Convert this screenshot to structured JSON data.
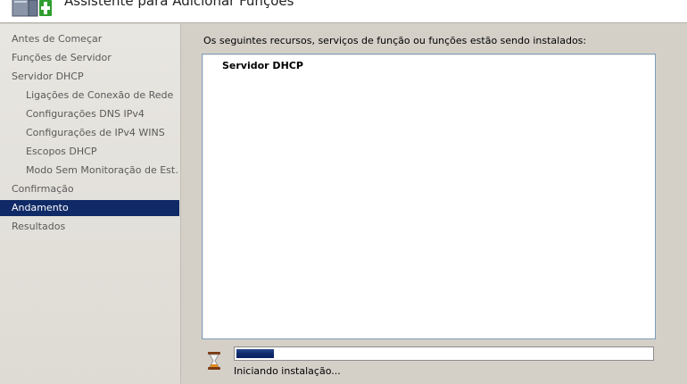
{
  "header": {
    "title": "Assistente para Adicionar Funções"
  },
  "sidebar": {
    "items": [
      {
        "label": "Antes de Começar",
        "level": 1,
        "active": false
      },
      {
        "label": "Funções de Servidor",
        "level": 1,
        "active": false
      },
      {
        "label": "Servidor DHCP",
        "level": 1,
        "active": false
      },
      {
        "label": "Ligações de Conexão de Rede",
        "level": 2,
        "active": false
      },
      {
        "label": "Configurações DNS IPv4",
        "level": 2,
        "active": false
      },
      {
        "label": "Configurações de IPv4 WINS",
        "level": 2,
        "active": false
      },
      {
        "label": "Escopos DHCP",
        "level": 2,
        "active": false
      },
      {
        "label": "Modo Sem Monitoração de Est...",
        "level": 2,
        "active": false
      },
      {
        "label": "Confirmação",
        "level": 1,
        "active": false
      },
      {
        "label": "Andamento",
        "level": 1,
        "active": true
      },
      {
        "label": "Resultados",
        "level": 1,
        "active": false
      }
    ]
  },
  "main": {
    "instructions": "Os seguintes recursos, serviços de função ou funções estão sendo instalados:",
    "installing_items": [
      "Servidor DHCP"
    ],
    "progress": {
      "fraction": 0.09,
      "status_text": "Iniciando instalação..."
    }
  },
  "colors": {
    "active_nav_bg": "#0f2a66",
    "progress_fill": "#0e2a6a",
    "window_bg": "#d4d0c8"
  },
  "icons": {
    "header": "server-add-icon",
    "progress": "hourglass-icon"
  }
}
